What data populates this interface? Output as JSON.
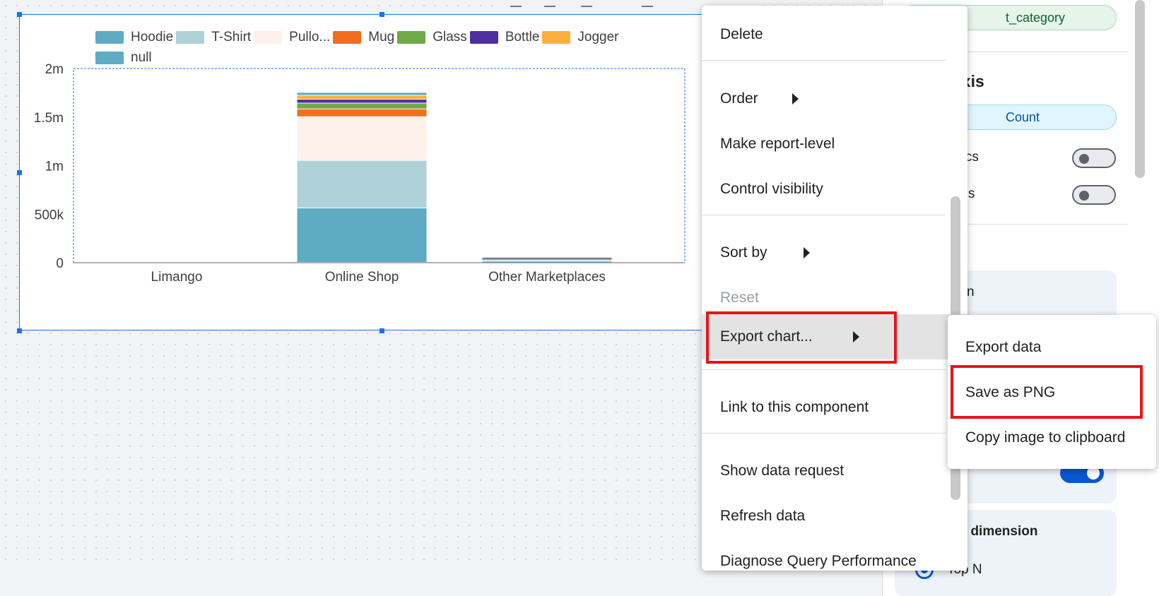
{
  "chart": {
    "legend": [
      {
        "label": "Hoodie",
        "color": "#5fabc3"
      },
      {
        "label": "T-Shirt",
        "color": "#afd1d8"
      },
      {
        "label": "Pullo...",
        "color": "#fcf1eb"
      },
      {
        "label": "Mug",
        "color": "#f36d1e"
      },
      {
        "label": "Glass",
        "color": "#6eaa46"
      },
      {
        "label": "Bottle",
        "color": "#4f2fa0"
      },
      {
        "label": "Jogger",
        "color": "#fbb03b"
      },
      {
        "label": "null",
        "color": "#5fabc3"
      }
    ]
  },
  "chart_data": {
    "type": "bar",
    "stacked": true,
    "categories": [
      "Limango",
      "Online Shop",
      "Other Marketplaces"
    ],
    "series": [
      {
        "name": "Hoodie",
        "values": [
          0,
          560000,
          10000
        ]
      },
      {
        "name": "T-Shirt",
        "values": [
          0,
          490000,
          10000
        ]
      },
      {
        "name": "Pullo...",
        "values": [
          0,
          450000,
          10000
        ]
      },
      {
        "name": "Mug",
        "values": [
          0,
          80000,
          8000
        ]
      },
      {
        "name": "Glass",
        "values": [
          0,
          60000,
          5000
        ]
      },
      {
        "name": "Bottle",
        "values": [
          0,
          40000,
          3000
        ]
      },
      {
        "name": "Jogger",
        "values": [
          0,
          40000,
          5000
        ]
      },
      {
        "name": "null",
        "values": [
          0,
          30000,
          3000
        ]
      }
    ],
    "yticks": [
      {
        "value": 0,
        "label": "0"
      },
      {
        "value": 500000,
        "label": "500k"
      },
      {
        "value": 1000000,
        "label": "1m"
      },
      {
        "value": 1500000,
        "label": "1.5m"
      },
      {
        "value": 2000000,
        "label": "2m"
      }
    ],
    "ylim": [
      0,
      2000000
    ],
    "grid": false,
    "legend": "top-left"
  },
  "context_menu": {
    "delete": "Delete",
    "order": "Order",
    "make_report_level": "Make report-level",
    "control_visibility": "Control visibility",
    "sort_by": "Sort by",
    "reset": "Reset",
    "export_chart": "Export chart...",
    "link_component": "Link to this component",
    "show_data_request": "Show data request",
    "refresh_data": "Refresh data",
    "diagnose": "Diagnose Query Performance"
  },
  "export_submenu": {
    "export_data": "Export data",
    "save_png": "Save as PNG",
    "copy_image": "Copy image to clipboard"
  },
  "properties_panel": {
    "dimension_chip": "t_category",
    "axis_title": "axis",
    "metric_chip": "Count",
    "metrics_label": "trics",
    "s_label": "s",
    "card1_text": "n",
    "drilldown_label": "vn dimension",
    "top_n_label": "Top N"
  },
  "colors": {
    "selection": "#1a73e8",
    "highlight": "#e8141b",
    "toggle_on": "#0b57d0"
  }
}
